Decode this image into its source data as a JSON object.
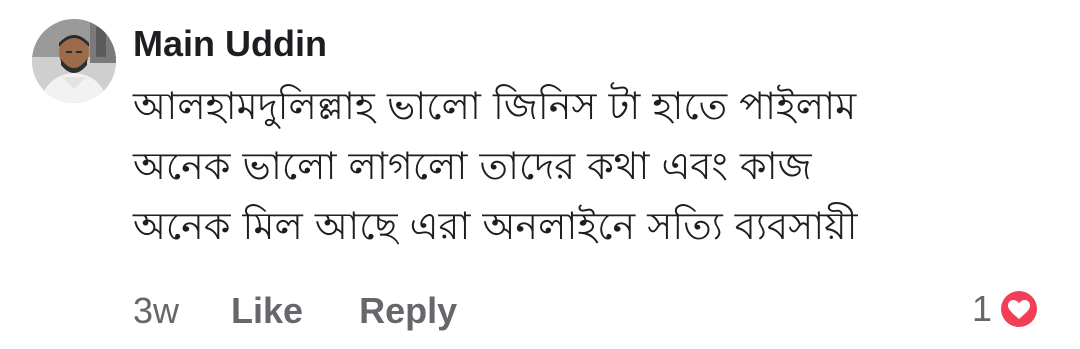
{
  "comment": {
    "author": "Main Uddin",
    "text_lines": [
      "আলহামদুলিল্লাহ ভালো জিনিস টা হাতে পাইলাম",
      "অনেক ভালো লাগলো তাদের কথা এবং কাজ",
      "অনেক মিল আছে এরা অনলাইনে সত্যি ব্যবসায়ী"
    ],
    "timestamp": "3w",
    "actions": {
      "like_label": "Like",
      "reply_label": "Reply"
    },
    "reactions": {
      "count": "1",
      "icon": "love-icon",
      "color": "#f33e58"
    }
  }
}
